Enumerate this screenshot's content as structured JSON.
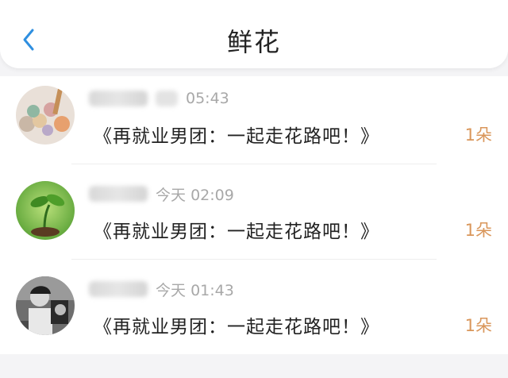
{
  "header": {
    "back_icon": "chevron-left-icon",
    "title": "鲜花",
    "accent_color": "#2f8fe0"
  },
  "items": [
    {
      "name": "",
      "date_prefix": "",
      "time": "05:43",
      "message": "《再就业男团：一起走花路吧！》",
      "count": "1朵"
    },
    {
      "name": "",
      "date_prefix": "今天",
      "time": "02:09",
      "message": "《再就业男团：一起走花路吧！》",
      "count": "1朵"
    },
    {
      "name": "",
      "date_prefix": "今天",
      "time": "01:43",
      "message": "《再就业男团：一起走花路吧！》",
      "count": "1朵"
    }
  ]
}
